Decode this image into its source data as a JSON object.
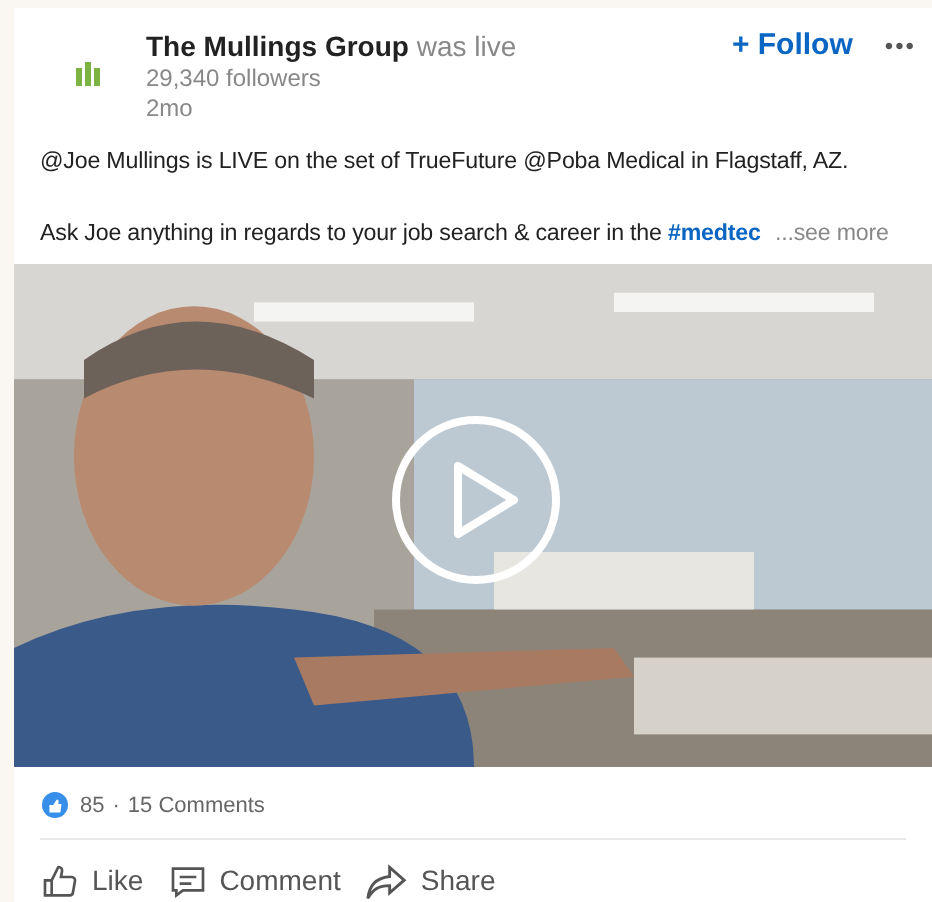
{
  "post": {
    "author": "The Mullings Group",
    "status": "was live",
    "followers": "29,340 followers",
    "age": "2mo",
    "follow_label": "+ Follow",
    "menu": "•••",
    "text_line_1": "@Joe Mullings is LIVE on the set of TrueFuture @Poba Medical in Flagstaff, AZ.",
    "text_line_2": "Ask Joe anything in regards to your job search & career in the",
    "hashtag": "#medtec",
    "see_more": "...see more",
    "video": {
      "kind": "picture",
      "playable": true
    },
    "reactions": "85",
    "separator": "·",
    "comments": "15 Comments",
    "actions": [
      {
        "kind": "like",
        "label": "Like"
      },
      {
        "kind": "comment",
        "label": "Comment"
      },
      {
        "kind": "share",
        "label": "Share"
      }
    ]
  }
}
